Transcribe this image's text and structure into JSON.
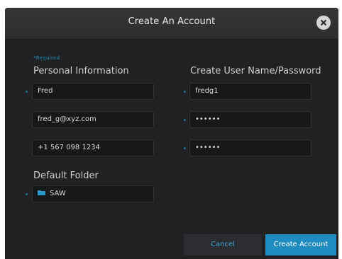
{
  "dialog": {
    "title": "Create An Account",
    "close_icon": "close-icon"
  },
  "form": {
    "required_note": "*Required",
    "personal_section_title": "Personal Information",
    "credentials_section_title": "Create User Name/Password",
    "default_folder_title": "Default Folder",
    "first_name_value": "Fred",
    "email_value": "fred_g@xyz.com",
    "phone_value": "+1 567 098 1234",
    "username_value": "fredg1",
    "password_value": "••••••",
    "confirm_password_value": "••••••",
    "folder_value": "SAW",
    "folder_icon": "folder-icon"
  },
  "actions": {
    "cancel_label": "Cancel",
    "create_label": "Create Account"
  },
  "colors": {
    "accent": "#1e8cc0",
    "background": "#202123",
    "field_background": "#17181a"
  }
}
